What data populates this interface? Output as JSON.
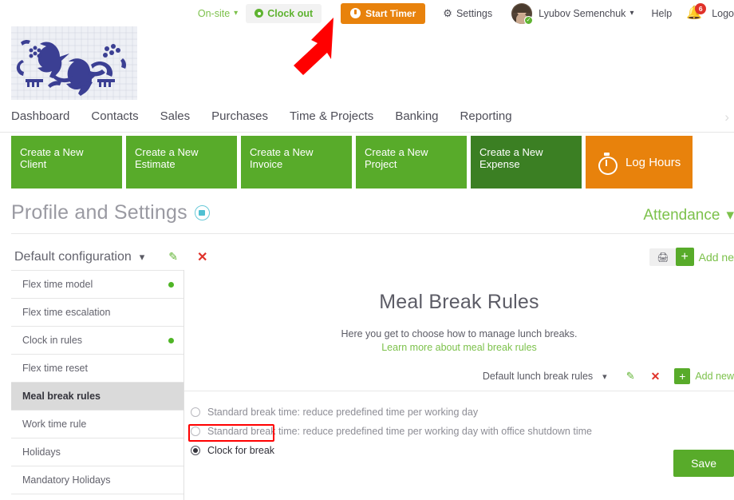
{
  "topbar": {
    "location_label": "On-site",
    "clock_out_label": "Clock out",
    "start_timer_label": "Start Timer",
    "settings_label": "Settings",
    "user_name": "Lyubov Semenchuk",
    "help_label": "Help",
    "notification_count": "6",
    "logout_label": "Logo",
    "accent_green": "#5fb331",
    "accent_orange": "#e8820c"
  },
  "nav": {
    "items": [
      {
        "label": "Dashboard"
      },
      {
        "label": "Contacts"
      },
      {
        "label": "Sales"
      },
      {
        "label": "Purchases"
      },
      {
        "label": "Time & Projects"
      },
      {
        "label": "Banking"
      },
      {
        "label": "Reporting"
      }
    ],
    "more_icon": "chevron-right-icon"
  },
  "tiles": [
    {
      "label": "Create a New\nClient",
      "style": "green"
    },
    {
      "label": "Create a New\nEstimate",
      "style": "green"
    },
    {
      "label": "Create a New\nInvoice",
      "style": "green"
    },
    {
      "label": "Create a New\nProject",
      "style": "green"
    },
    {
      "label": "Create a New\nExpense",
      "style": "dark-green"
    },
    {
      "label": "Log Hours",
      "style": "orange"
    }
  ],
  "page": {
    "title": "Profile and Settings",
    "video_icon": "video-icon",
    "section_label": "Attendance"
  },
  "config": {
    "name": "Default configuration",
    "chevron": "chevron-down-icon",
    "edit_icon": "pencil-icon",
    "delete_icon": "close-icon",
    "print_icon": "printer-icon",
    "add_new_label": "Add ne",
    "plus_icon": "plus-icon"
  },
  "sidebar": {
    "items": [
      {
        "label": "Flex time model",
        "status_dot": true,
        "active": false
      },
      {
        "label": "Flex time escalation",
        "status_dot": false,
        "active": false
      },
      {
        "label": "Clock in rules",
        "status_dot": true,
        "active": false
      },
      {
        "label": "Flex time reset",
        "status_dot": false,
        "active": false
      },
      {
        "label": "Meal break rules",
        "status_dot": false,
        "active": true
      },
      {
        "label": "Work time rule",
        "status_dot": false,
        "active": false
      },
      {
        "label": "Holidays",
        "status_dot": false,
        "active": false
      },
      {
        "label": "Mandatory Holidays",
        "status_dot": false,
        "active": false
      }
    ]
  },
  "main": {
    "heading": "Meal Break Rules",
    "description": "Here you get to choose how to manage lunch breaks.",
    "learn_more_label": "Learn more about meal break rules",
    "ruleset": {
      "name": "Default lunch break rules",
      "chevron": "chevron-down-icon",
      "edit_icon": "pencil-icon",
      "delete_icon": "close-icon",
      "plus_icon": "plus-icon",
      "add_new_label": "Add new"
    },
    "options": [
      {
        "label": "Standard break time: reduce predefined time per working day",
        "selected": false
      },
      {
        "label": "Standard break time: reduce predefined time per working day with office shutdown time",
        "selected": false
      },
      {
        "label": "Clock for break",
        "selected": true
      }
    ],
    "save_label": "Save"
  },
  "annotations": {
    "arrow_color": "#ff0000",
    "arrow_target": "clock-out-button",
    "highlight_color": "#ff0000",
    "highlight_target": "clock-for-break-option"
  }
}
